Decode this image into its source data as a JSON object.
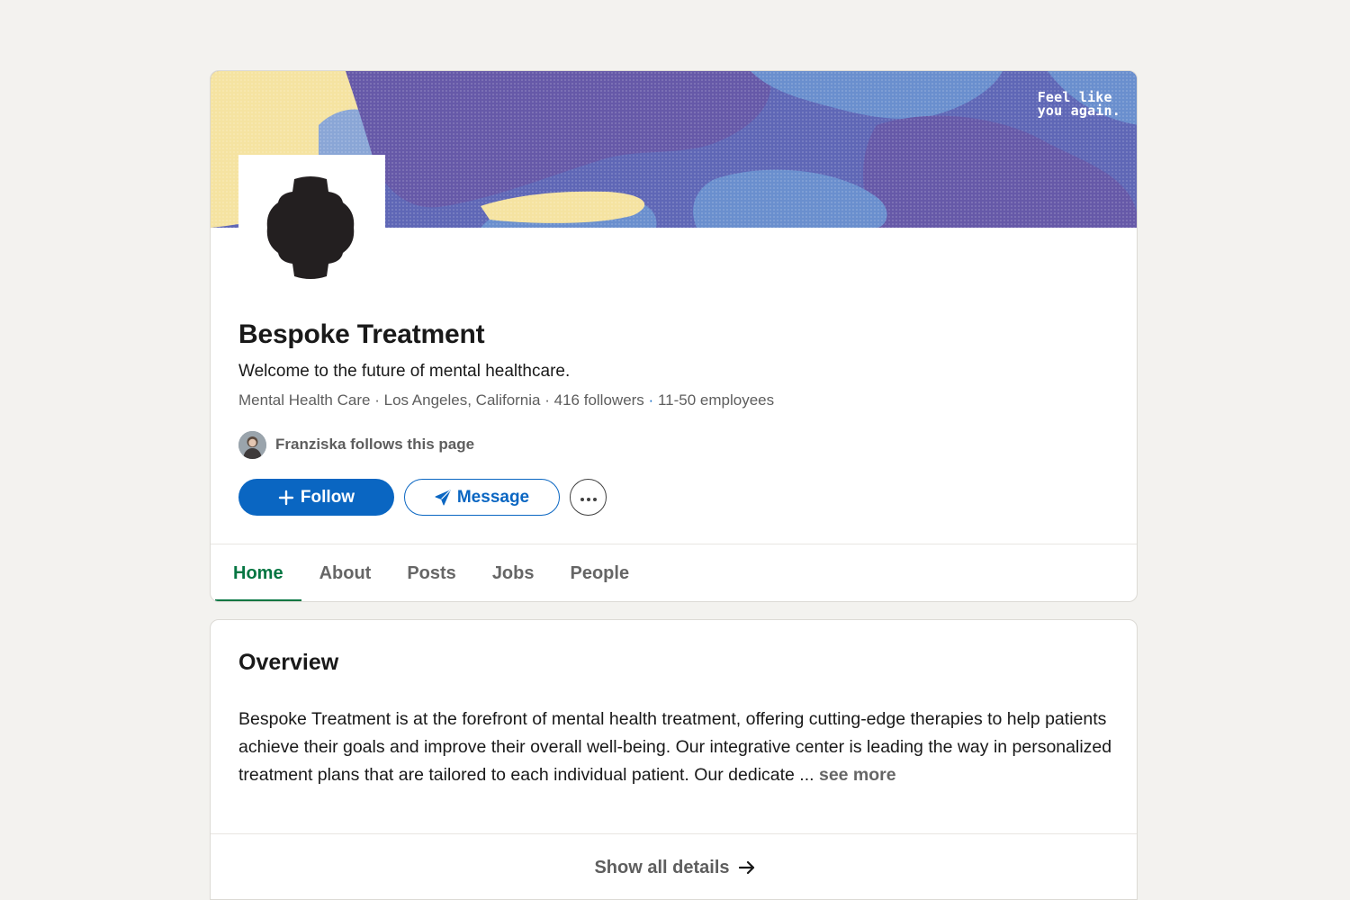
{
  "banner": {
    "tagline": "Feel like\nyou again."
  },
  "company": {
    "name": "Bespoke Treatment",
    "tagline": "Welcome to the future of mental healthcare.",
    "industry": "Mental Health Care",
    "location": "Los Angeles, California",
    "followers": "416 followers",
    "employees": "11-50 employees",
    "separator": "·"
  },
  "connection": {
    "text": "Franziska follows this page"
  },
  "actions": {
    "follow_label": "Follow",
    "message_label": "Message",
    "more_icon": "ellipsis-icon"
  },
  "tabs": [
    {
      "label": "Home",
      "active": true
    },
    {
      "label": "About",
      "active": false
    },
    {
      "label": "Posts",
      "active": false
    },
    {
      "label": "Jobs",
      "active": false
    },
    {
      "label": "People",
      "active": false
    }
  ],
  "overview": {
    "title": "Overview",
    "body": "Bespoke Treatment is at the forefront of mental health treatment, offering cutting-edge therapies to help patients achieve their goals and improve their overall well-being. Our integrative center is leading the way in personalized treatment plans that are tailored to each individual patient. Our dedicate ...",
    "see_more": "see more",
    "show_all": "Show all details"
  },
  "colors": {
    "brand_blue": "#0a66c2",
    "active_tab_green": "#057642",
    "banner_purple": "#6659a8",
    "banner_yellow": "#f5e3a1"
  }
}
